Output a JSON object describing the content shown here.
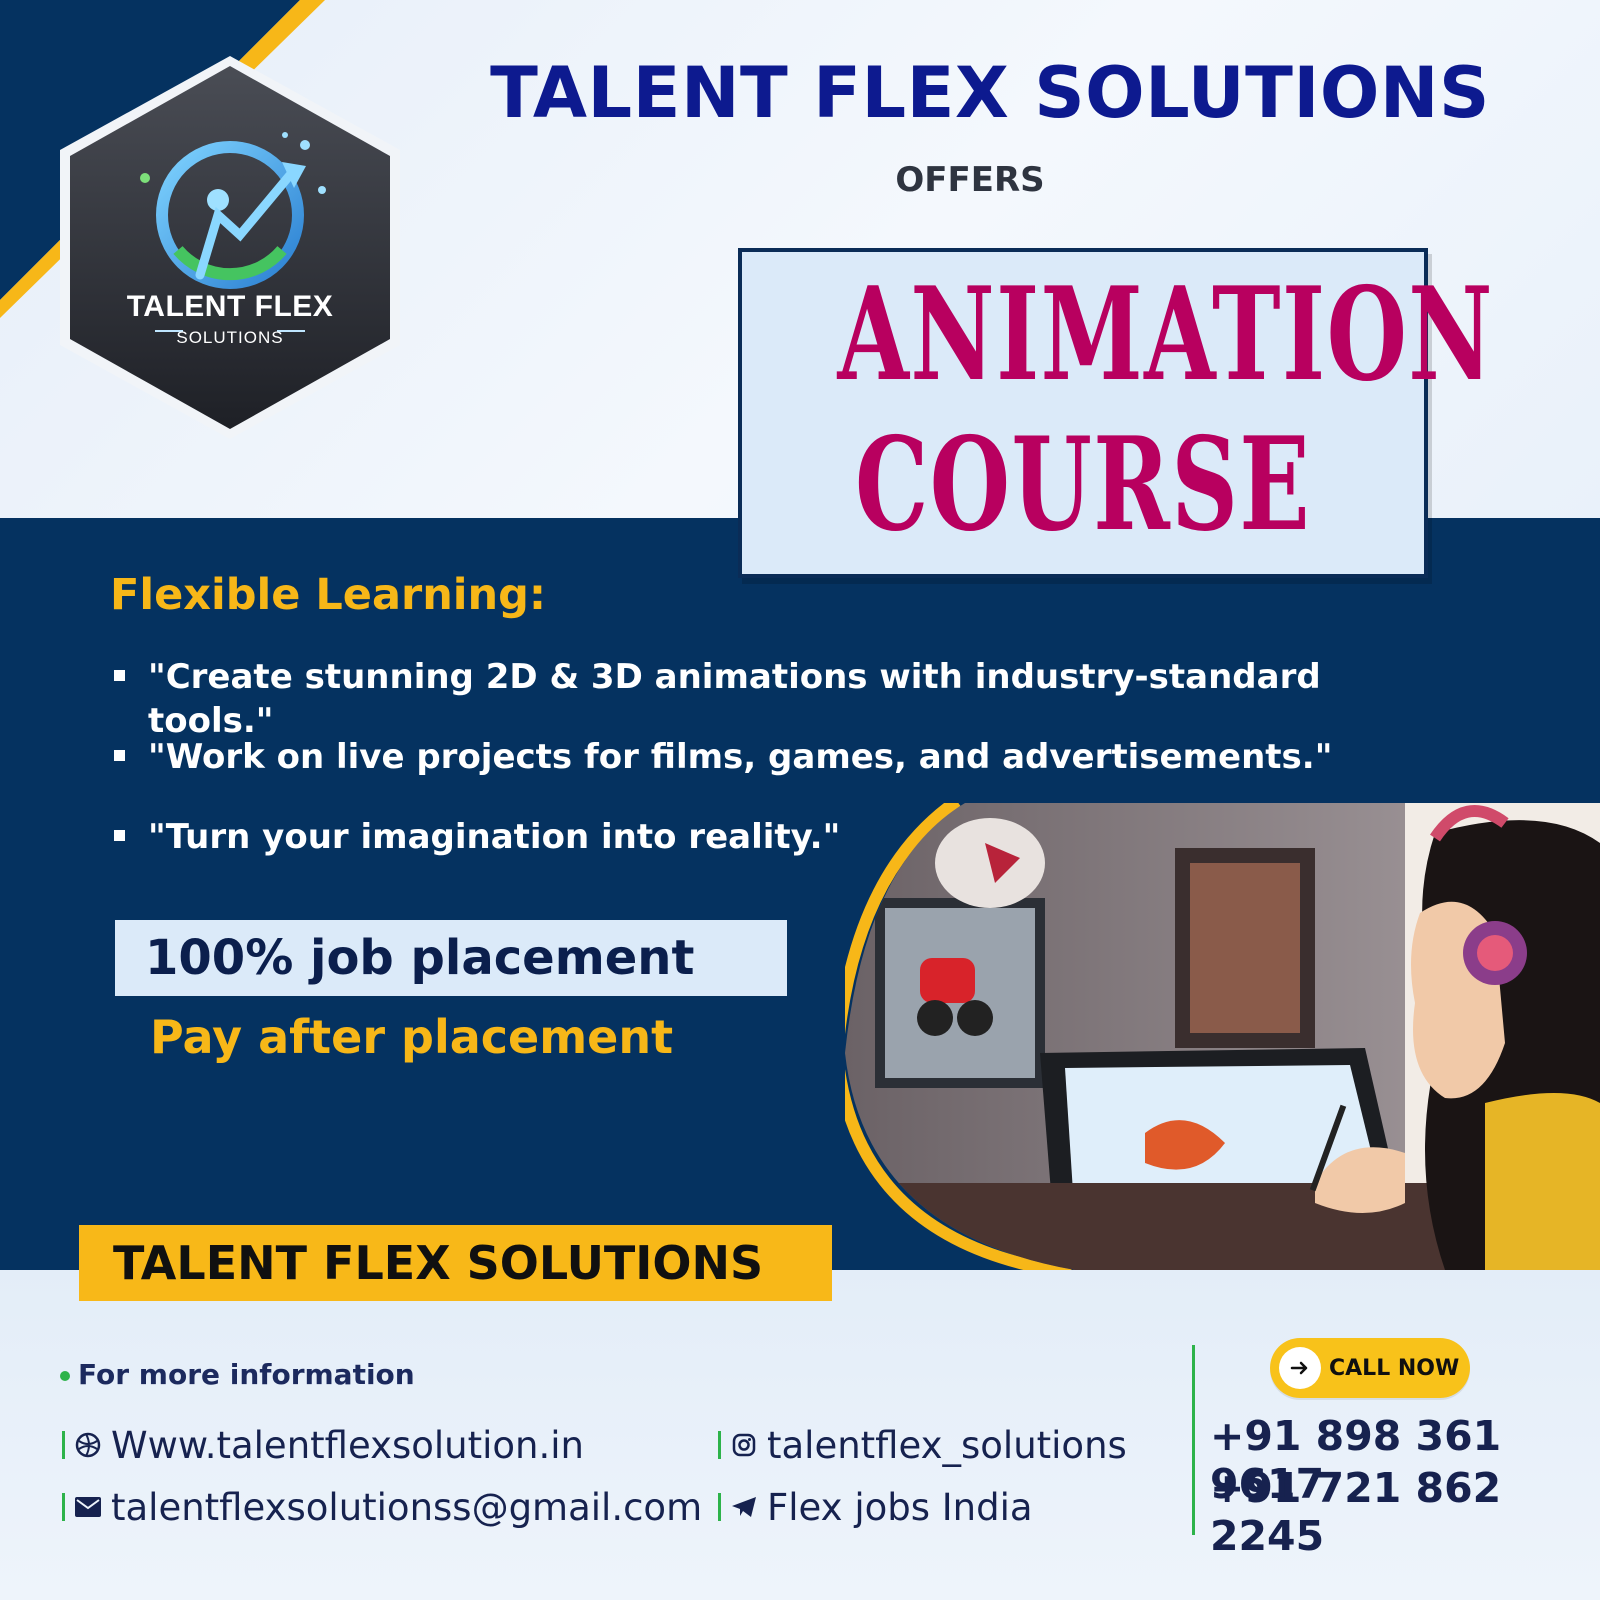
{
  "brand": {
    "title": "TALENT FLEX SOLUTIONS",
    "offers": "OFFERS"
  },
  "logo": {
    "title": "TALENT FLEX",
    "subtitle": "SOLUTIONS",
    "icon": "rising-person-arrow-icon"
  },
  "course": {
    "line1": "ANIMATION",
    "line2": "COURSE"
  },
  "learning": {
    "heading": "Flexible Learning:",
    "bullets": [
      "\"Create stunning 2D & 3D animations with industry-standard tools.\"",
      "\"Work on live projects for films, games, and advertisements.\"",
      "\"Turn your imagination into reality.\""
    ]
  },
  "placement": {
    "badge": "100% job placement",
    "pay": "Pay after placement"
  },
  "footer": {
    "banner": "TALENT FLEX SOLUTIONS",
    "more_info": "For more information",
    "website": "Www.talentflexsolution.in",
    "email": "talentflexsolutionss@gmail.com",
    "instagram": "talentflex_solutions",
    "telegram": "Flex jobs India",
    "call_now": "CALL NOW",
    "phones": [
      "+91 898 361 9617",
      "+91 721 862 2245"
    ]
  },
  "colors": {
    "navy": "#053260",
    "brand_blue": "#0d1a8f",
    "course_magenta": "#b8005f",
    "accent_yellow": "#f7b718",
    "divider_green": "#2db34a",
    "light_panel": "#dbeaf9"
  },
  "icons": {
    "website": "globe-icon",
    "email": "mail-icon",
    "instagram": "instagram-icon",
    "telegram": "telegram-icon",
    "call": "arrow-right-icon"
  }
}
